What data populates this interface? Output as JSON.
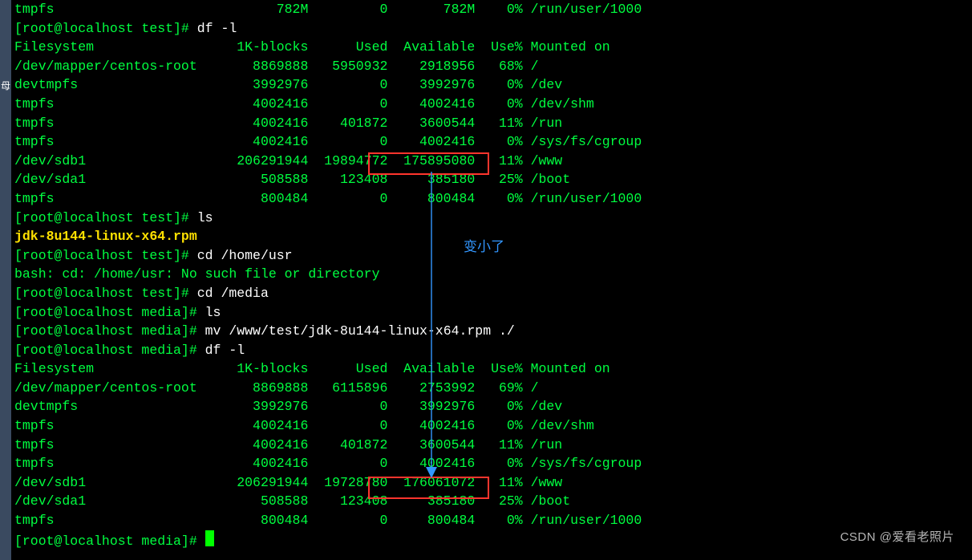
{
  "sidebar_label": "母",
  "line0": {
    "fs": "tmpfs",
    "kb": "782M",
    "used": "0",
    "avail": "782M",
    "usep": "0%",
    "mnt": "/run/user/1000"
  },
  "prompt_df1_user": "[root@localhost test]#",
  "prompt_df1_cmd": " df -l",
  "hdr": {
    "fs": "Filesystem",
    "kb": "1K-blocks",
    "used": "Used",
    "avail": "Available",
    "usep": "Use%",
    "mnt": "Mounted on"
  },
  "df1": [
    {
      "fs": "/dev/mapper/centos-root",
      "kb": "8869888",
      "used": "5950932",
      "avail": "2918956",
      "usep": "68%",
      "mnt": "/"
    },
    {
      "fs": "devtmpfs",
      "kb": "3992976",
      "used": "0",
      "avail": "3992976",
      "usep": "0%",
      "mnt": "/dev"
    },
    {
      "fs": "tmpfs",
      "kb": "4002416",
      "used": "0",
      "avail": "4002416",
      "usep": "0%",
      "mnt": "/dev/shm"
    },
    {
      "fs": "tmpfs",
      "kb": "4002416",
      "used": "401872",
      "avail": "3600544",
      "usep": "11%",
      "mnt": "/run"
    },
    {
      "fs": "tmpfs",
      "kb": "4002416",
      "used": "0",
      "avail": "4002416",
      "usep": "0%",
      "mnt": "/sys/fs/cgroup"
    },
    {
      "fs": "/dev/sdb1",
      "kb": "206291944",
      "used": "19894772",
      "avail": "175895080",
      "usep": "11%",
      "mnt": "/www"
    },
    {
      "fs": "/dev/sda1",
      "kb": "508588",
      "used": "123408",
      "avail": "385180",
      "usep": "25%",
      "mnt": "/boot"
    },
    {
      "fs": "tmpfs",
      "kb": "800484",
      "used": "0",
      "avail": "800484",
      "usep": "0%",
      "mnt": "/run/user/1000"
    }
  ],
  "prompt_ls_user": "[root@localhost test]#",
  "prompt_ls_cmd": " ls",
  "ls_out": "jdk-8u144-linux-x64.rpm",
  "prompt_cd1_user": "[root@localhost test]#",
  "prompt_cd1_cmd": " cd /home/usr",
  "cd1_err": "bash: cd: /home/usr: No such file or directory",
  "prompt_cd2_user": "[root@localhost test]#",
  "prompt_cd2_cmd": " cd /media",
  "prompt_ls2_user": "[root@localhost media]#",
  "prompt_ls2_cmd": " ls",
  "prompt_mv_user": "[root@localhost media]#",
  "prompt_mv_cmd": " mv /www/test/jdk-8u144-linux-x64.rpm ./",
  "prompt_df2_user": "[root@localhost media]#",
  "prompt_df2_cmd": " df -l",
  "df2": [
    {
      "fs": "/dev/mapper/centos-root",
      "kb": "8869888",
      "used": "6115896",
      "avail": "2753992",
      "usep": "69%",
      "mnt": "/"
    },
    {
      "fs": "devtmpfs",
      "kb": "3992976",
      "used": "0",
      "avail": "3992976",
      "usep": "0%",
      "mnt": "/dev"
    },
    {
      "fs": "tmpfs",
      "kb": "4002416",
      "used": "0",
      "avail": "4002416",
      "usep": "0%",
      "mnt": "/dev/shm"
    },
    {
      "fs": "tmpfs",
      "kb": "4002416",
      "used": "401872",
      "avail": "3600544",
      "usep": "11%",
      "mnt": "/run"
    },
    {
      "fs": "tmpfs",
      "kb": "4002416",
      "used": "0",
      "avail": "4002416",
      "usep": "0%",
      "mnt": "/sys/fs/cgroup"
    },
    {
      "fs": "/dev/sdb1",
      "kb": "206291944",
      "used": "19728780",
      "avail": "176061072",
      "usep": "11%",
      "mnt": "/www"
    },
    {
      "fs": "/dev/sda1",
      "kb": "508588",
      "used": "123408",
      "avail": "385180",
      "usep": "25%",
      "mnt": "/boot"
    },
    {
      "fs": "tmpfs",
      "kb": "800484",
      "used": "0",
      "avail": "800484",
      "usep": "0%",
      "mnt": "/run/user/1000"
    }
  ],
  "prompt_final_user": "[root@localhost media]#",
  "annotation": "变小了",
  "highlight1": "19894772",
  "highlight2": "19728780",
  "watermark": "CSDN @爱看老照片"
}
